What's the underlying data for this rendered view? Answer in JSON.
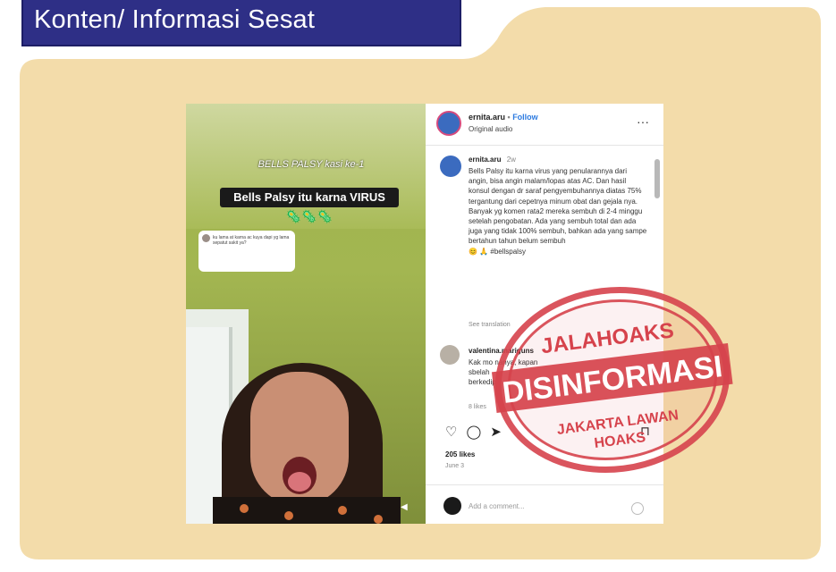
{
  "header": {
    "title": "Konten/ Informasi Sesat"
  },
  "colors": {
    "accent": "#2e2f86",
    "card": "#f3dcaa",
    "stamp": "#d6434c"
  },
  "video": {
    "caption": "BELLS PALSY kasi ke-1",
    "title": "Bells Palsy itu karna VIRUS",
    "emojis": "🦠🦠🦠",
    "comment": "ku lama at karna ac kuya dapi yg lama sepatut sakit ya?"
  },
  "post": {
    "username": "ernita.aru",
    "follow": "Follow",
    "audio": "Original audio",
    "more": "···",
    "caption_user": "ernita.aru",
    "caption_time": "2w",
    "caption": "Bells Palsy itu karna virus yang penularannya dari angin, bisa angin malam/lopas atas AC. Dan hasil konsul dengan dr saraf pengyembuhannya diatas 75% tergantung dari cepetnya minum obat dan gejala nya.\nBanyak yg komen rata2 mereka sembuh di 2-4 minggu setelah pengobatan. Ada yang sembuh total dan ada juga yang tidak 100% sembuh, bahkan ada yang sampe bertahun tahun belum sembuh\n😊 🙏 #bellspalsy",
    "see_translation": "See translation",
    "comment_user": "valentina.mariguns",
    "comment_text": "Kak mo nanya, kapan\nsbelah\nberkedip",
    "comment_likes": "8 likes",
    "likes": "205 likes",
    "date": "June 3",
    "add_comment": "Add a comment..."
  },
  "stamp": {
    "top": "JALAHOAKS",
    "middle": "DISINFORMASI",
    "bottom1": "JAKARTA LAWAN",
    "bottom2": "HOAKS"
  }
}
